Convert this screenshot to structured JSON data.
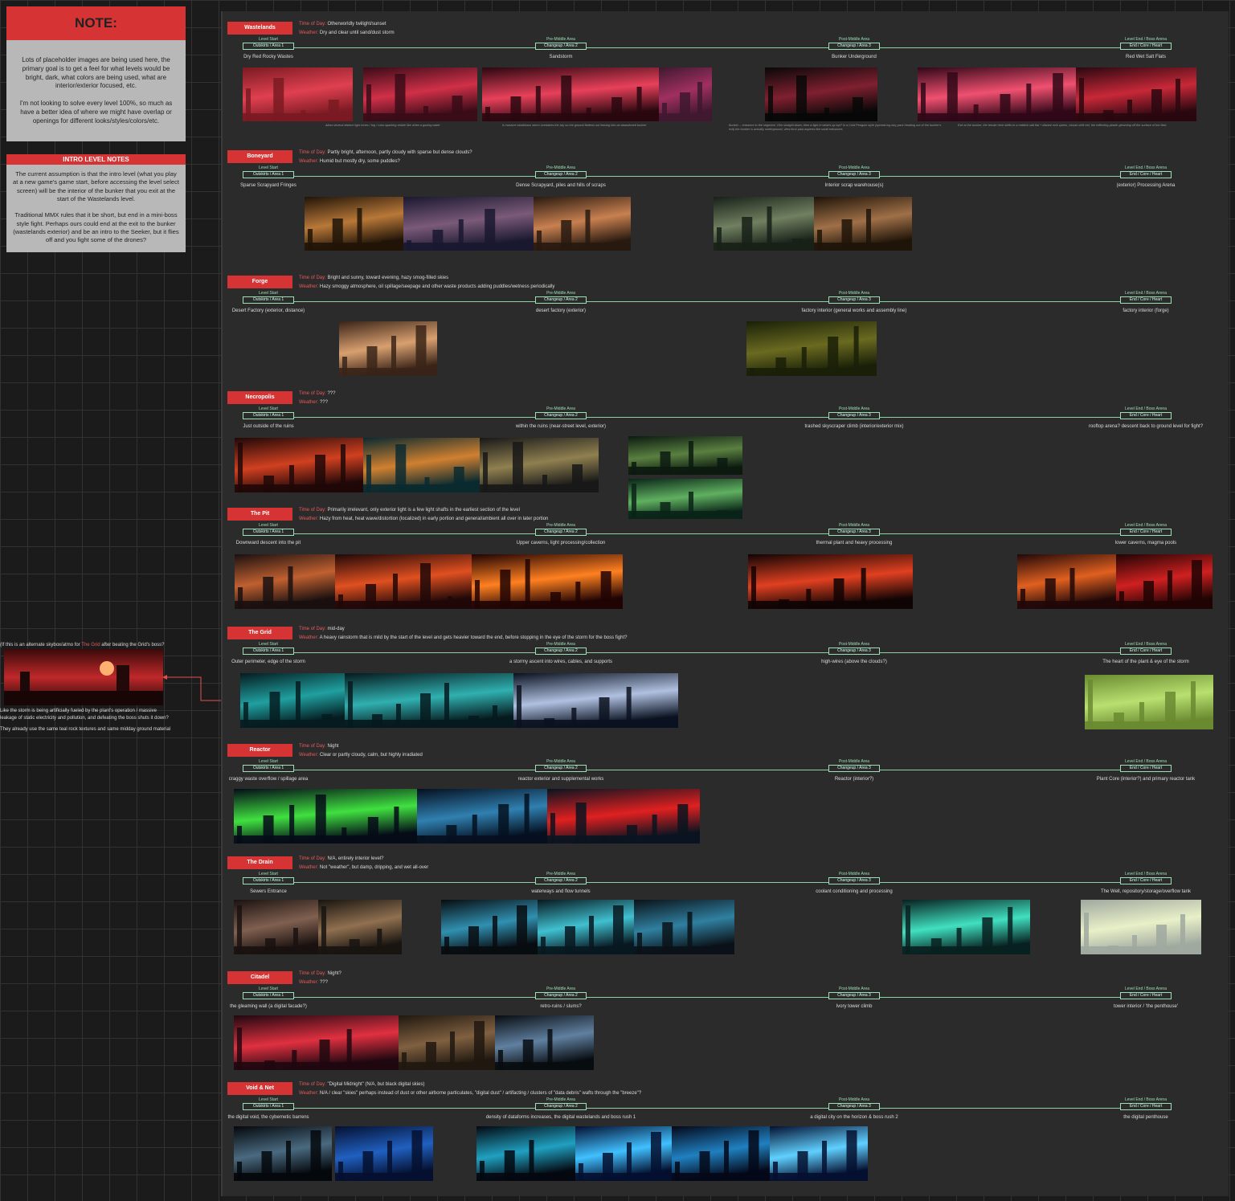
{
  "note": {
    "title": "NOTE:",
    "body": "Lots of placeholder images are being used here, the primary goal is to get a feel for what levels would be bright, dark, what colors are being used, what are interior/exterior focused, etc.\n\nI'm not looking to solve every level 100%, so much as have a better idea of where we might have overlap or openings for different looks/styles/colors/etc."
  },
  "intro": {
    "title": "INTRO LEVEL NOTES",
    "body": "The current assumption is that the intro level (what you play at a new game's game start, before accessing the level select screen) will be the interior of the bunker that you exit at the start of the Wastelands level.\n\nTraditional MMX rules that it be short, but end in a mini-boss style fight. Perhaps ours could end at the exit to the bunker (wastelands exterior) and be an intro to the Seeker, but it flies off and you fight some of the drones?"
  },
  "labels": {
    "tod": "Time of Day:",
    "weather": "Weather:"
  },
  "stages": [
    {
      "top": "Level Start",
      "box": "Outskirts / Area 1"
    },
    {
      "top": "Pre-Middle Area",
      "box": "Changeup / Area 2"
    },
    {
      "top": "Post-Middle Area",
      "box": "Changeup / Area 3"
    },
    {
      "top": "Level End / Boss Arena",
      "box": "End / Core / Heart"
    }
  ],
  "grid_side": {
    "q_pre": "(If this is an alternate skybox/atmo for ",
    "q_red": "The Grid",
    "q_post": " after beating the Grid's boss?",
    "note1": "Like the storm is being artificially fueled by the plant's operation / massive",
    "note2": "leakage of static electricity and pollution, and defeating the boss shuts it down?",
    "note3": "They already use the same teal rock textures and same midday ground material"
  },
  "sections": [
    {
      "name": "Wastelands",
      "tod": "Otherworldly twilight/sunset",
      "weather": "Dry and clear until sand/dust storm",
      "descs": [
        "Dry Red Rocky Wastes",
        "Sandstorm",
        "Bunker Underground",
        "Red Wet Salt Flats"
      ]
    },
    {
      "name": "Boneyard",
      "tod": "Partly bright, afternoon, partly cloudy with sparse but dense clouds?",
      "weather": "Humid but mostly dry, some puddles?",
      "descs": [
        "Sparse Scrapyard Fringes",
        "Dense Scrapyard, piles and hills of scraps",
        "Interior scrap warehouse(s)",
        "(exterior) Processing Arena"
      ]
    },
    {
      "name": "Forge",
      "tod": "Bright and sunny, toward evening, hazy smog-filled skies",
      "weather": "Hazy smoggy atmosphere, oil spillage/seepage and other waste products adding puddles/wetness periodically",
      "descs": [
        "Desert Factory (exterior, distance)",
        "desert factory (exterior)",
        "factory interior (general works and assembly line)",
        "factory interior (forge)"
      ]
    },
    {
      "name": "Necropolis",
      "tod": "???",
      "weather": "???",
      "descs": [
        "Just outside of the ruins",
        "within the ruins (near-street level, exterior)",
        "trashed skyscraper climb (interior/exterior mix)",
        "rooftop arena? descent back to ground level for fight?"
      ]
    },
    {
      "name": "The Pit",
      "tod": "Primarily irrelevant, only exterior light is a few light shafts in the earliest section of the level",
      "weather": "Hazy from heat, heat wave/distortion (localized) in early portion and general/ambient all over in later portion",
      "descs": [
        "Downward descent into the pit",
        "Upper caverns, light processing/collection",
        "thermal plant and heavy processing",
        "lower caverns, magma pools"
      ]
    },
    {
      "name": "The Grid",
      "tod": "mid-day",
      "weather": "A heavy rainstorm that is mild by the start of the level and gets heavier toward the end, before stopping in the eye of the storm for the boss fight?",
      "descs": [
        "Outer perimeter, edge of the storm",
        "a stormy ascent into  wires, cables, and supports",
        "high-wires (above the clouds?)",
        "The heart of the plant & eye of the storm"
      ]
    },
    {
      "name": "Reactor",
      "tod": "Night",
      "weather": "Clear or partly cloudy, calm, but highly irradiated",
      "descs": [
        "craggy waste overflow / spillage area",
        "reactor exterior and supplemental works",
        "Reactor (interior?)",
        "Plant Core (interior?) and primary reactor tank"
      ]
    },
    {
      "name": "The Drain",
      "tod": "N/A, entirely interior level?",
      "weather": "Not \"weather\", but damp, dripping, and wet all-over",
      "descs": [
        "Sewers Entrance",
        "waterways and flow tunnels",
        "coolant conditioning and processing",
        "The Well, repository/storage/overflow tank"
      ]
    },
    {
      "name": "Citadel",
      "tod": "Night?",
      "weather": "???",
      "descs": [
        "the gleaming wall (a digital facade?)",
        "retro-ruins / slums?",
        "Ivory tower climb",
        "tower interior / 'the penthouse'"
      ]
    },
    {
      "name": "Void & Net",
      "tod": "\"Digital Midnight\" (N/A, but black digital skies)",
      "weather": "N/A / clear \"skies\" perhaps instead of dust or other airborne particulates, \"digital dust\" / artifacting / clusters of \"data debris\" wafts through the \"breeze\"?",
      "descs": [
        "the digital void, the cybernetic barrens",
        "density of dataforms increases, the digital wastelands and boss rush 1",
        "a digital city on the horizon & boss rush 2",
        "the digital penthouse"
      ]
    }
  ],
  "captions": [
    "Allow several distinct light tones / fog / robo-sparking visible like when a gazing water",
    "A massive windblown storm overtakes the sky so the ground flattens out leaving into an abandoned bunker",
    "Bunker -- entrance to the segment, 10m straight down, then a light in what's up top? In a Cold Penguin style (spread-ing day pack heading out of the bunker's exit) the bunker is actually underground, view thru/ past aspects like small entrances",
    "Exit at the bunker, the terrain here shifts to a reddish salt flat + distant rock spires, clouds shift red, the reflecting plastic gleaming off the surface of the flats"
  ]
}
